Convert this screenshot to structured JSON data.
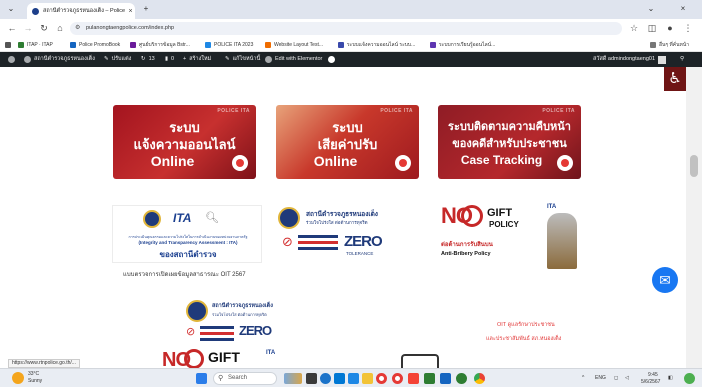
{
  "browser": {
    "tab_title": "สถานีตำรวจภูธรหนองเต็ง – Police I",
    "new_tab": "+",
    "url": "pulanongtaengpolice.com/index.php",
    "bookmarks": [
      {
        "label": "ITAP · ITAP",
        "color": "#2e7d32"
      },
      {
        "label": "Police PromoBook",
        "color": "#1565c0"
      },
      {
        "label": "ศูนย์บริการข้อมูล Bstr...",
        "color": "#6a1b9a"
      },
      {
        "label": "POLICE ITA 2023",
        "color": "#1e88e5"
      },
      {
        "label": "Website Layout Test...",
        "color": "#ef6c00"
      },
      {
        "label": "ระบบแจ้งความออนไลน์ ระบบ...",
        "color": "#3949ab"
      },
      {
        "label": "ระบบการเรียนรู้ออนไลน์...",
        "color": "#5e35b1"
      }
    ],
    "bookmarks_right": "อื่นๆ ที่คั่นหน้า"
  },
  "wp_admin": {
    "site_name": "สถานีตำรวจภูธรหนองเต็ง",
    "customize": "ปรับแต่ง",
    "updates": "13",
    "comments": "0",
    "new": "สร้างใหม่",
    "edit_page": "แก้ไขหน้านี้",
    "elementor": "Edit with Elementor",
    "howdy": "สวัสดี admindongtaeng01"
  },
  "banners": [
    {
      "line1": "ระบบ",
      "line2": "แจ้งความออนไลน์",
      "line3": "Online",
      "small": "POLICE ITA"
    },
    {
      "line1": "ระบบ",
      "line2": "เสียค่าปรับ",
      "line3": "Online",
      "small": "POLICE ITA"
    },
    {
      "line1": "ระบบติดตามความคืบหน้า",
      "line2": "ของคดีสำหรับประชาชน",
      "line3": "Case Tracking",
      "small": "POLICE ITA"
    }
  ],
  "ita_card": {
    "brand": "ITA",
    "desc1": "การประเมินคุณธรรมและความโปร่งใสในการดำเนินงานของหน่วยงานภาครัฐ",
    "desc2": "(Integrity and Transparency Assessment : ITA)",
    "station": "ของสถานีตำรวจ",
    "caption": "แบบตรวจการเปิดเผยข้อมูลสาธารณะ OIT 2567"
  },
  "zero_card": {
    "station": "สถานีตำรวจภูธรหนองเต็ง",
    "sub": "ร่วมใจโปร่งใส ต่อต้านการทุจริต",
    "zero": "ZERO",
    "tolerance": "TOLERANCE"
  },
  "nogift_card": {
    "no": "NO",
    "gift": "GIFT",
    "policy": "POLICY",
    "ita": "ITA",
    "thai": "ต่อต้านการรับสินบน",
    "anti": "Anti-Bribery Policy"
  },
  "oit_text": {
    "line1": "OIT ดูแลรักษาประชาชน",
    "line2": "และประชาสัมพันธ์ สภ.หนองเต็ง"
  },
  "status_url": "https://www.rtnpolice.go.th/...",
  "taskbar": {
    "weather_temp": "33°C",
    "weather_desc": "Sunny",
    "search": "Search",
    "lang": "ENG",
    "time": "9:45",
    "date": "5/6/2567"
  },
  "colors": {
    "banner1": "#b8232b",
    "banner2": "#c2382a",
    "banner3": "#8f1c25",
    "wp_bar": "#1d2327",
    "navy": "#1f3a7a"
  }
}
